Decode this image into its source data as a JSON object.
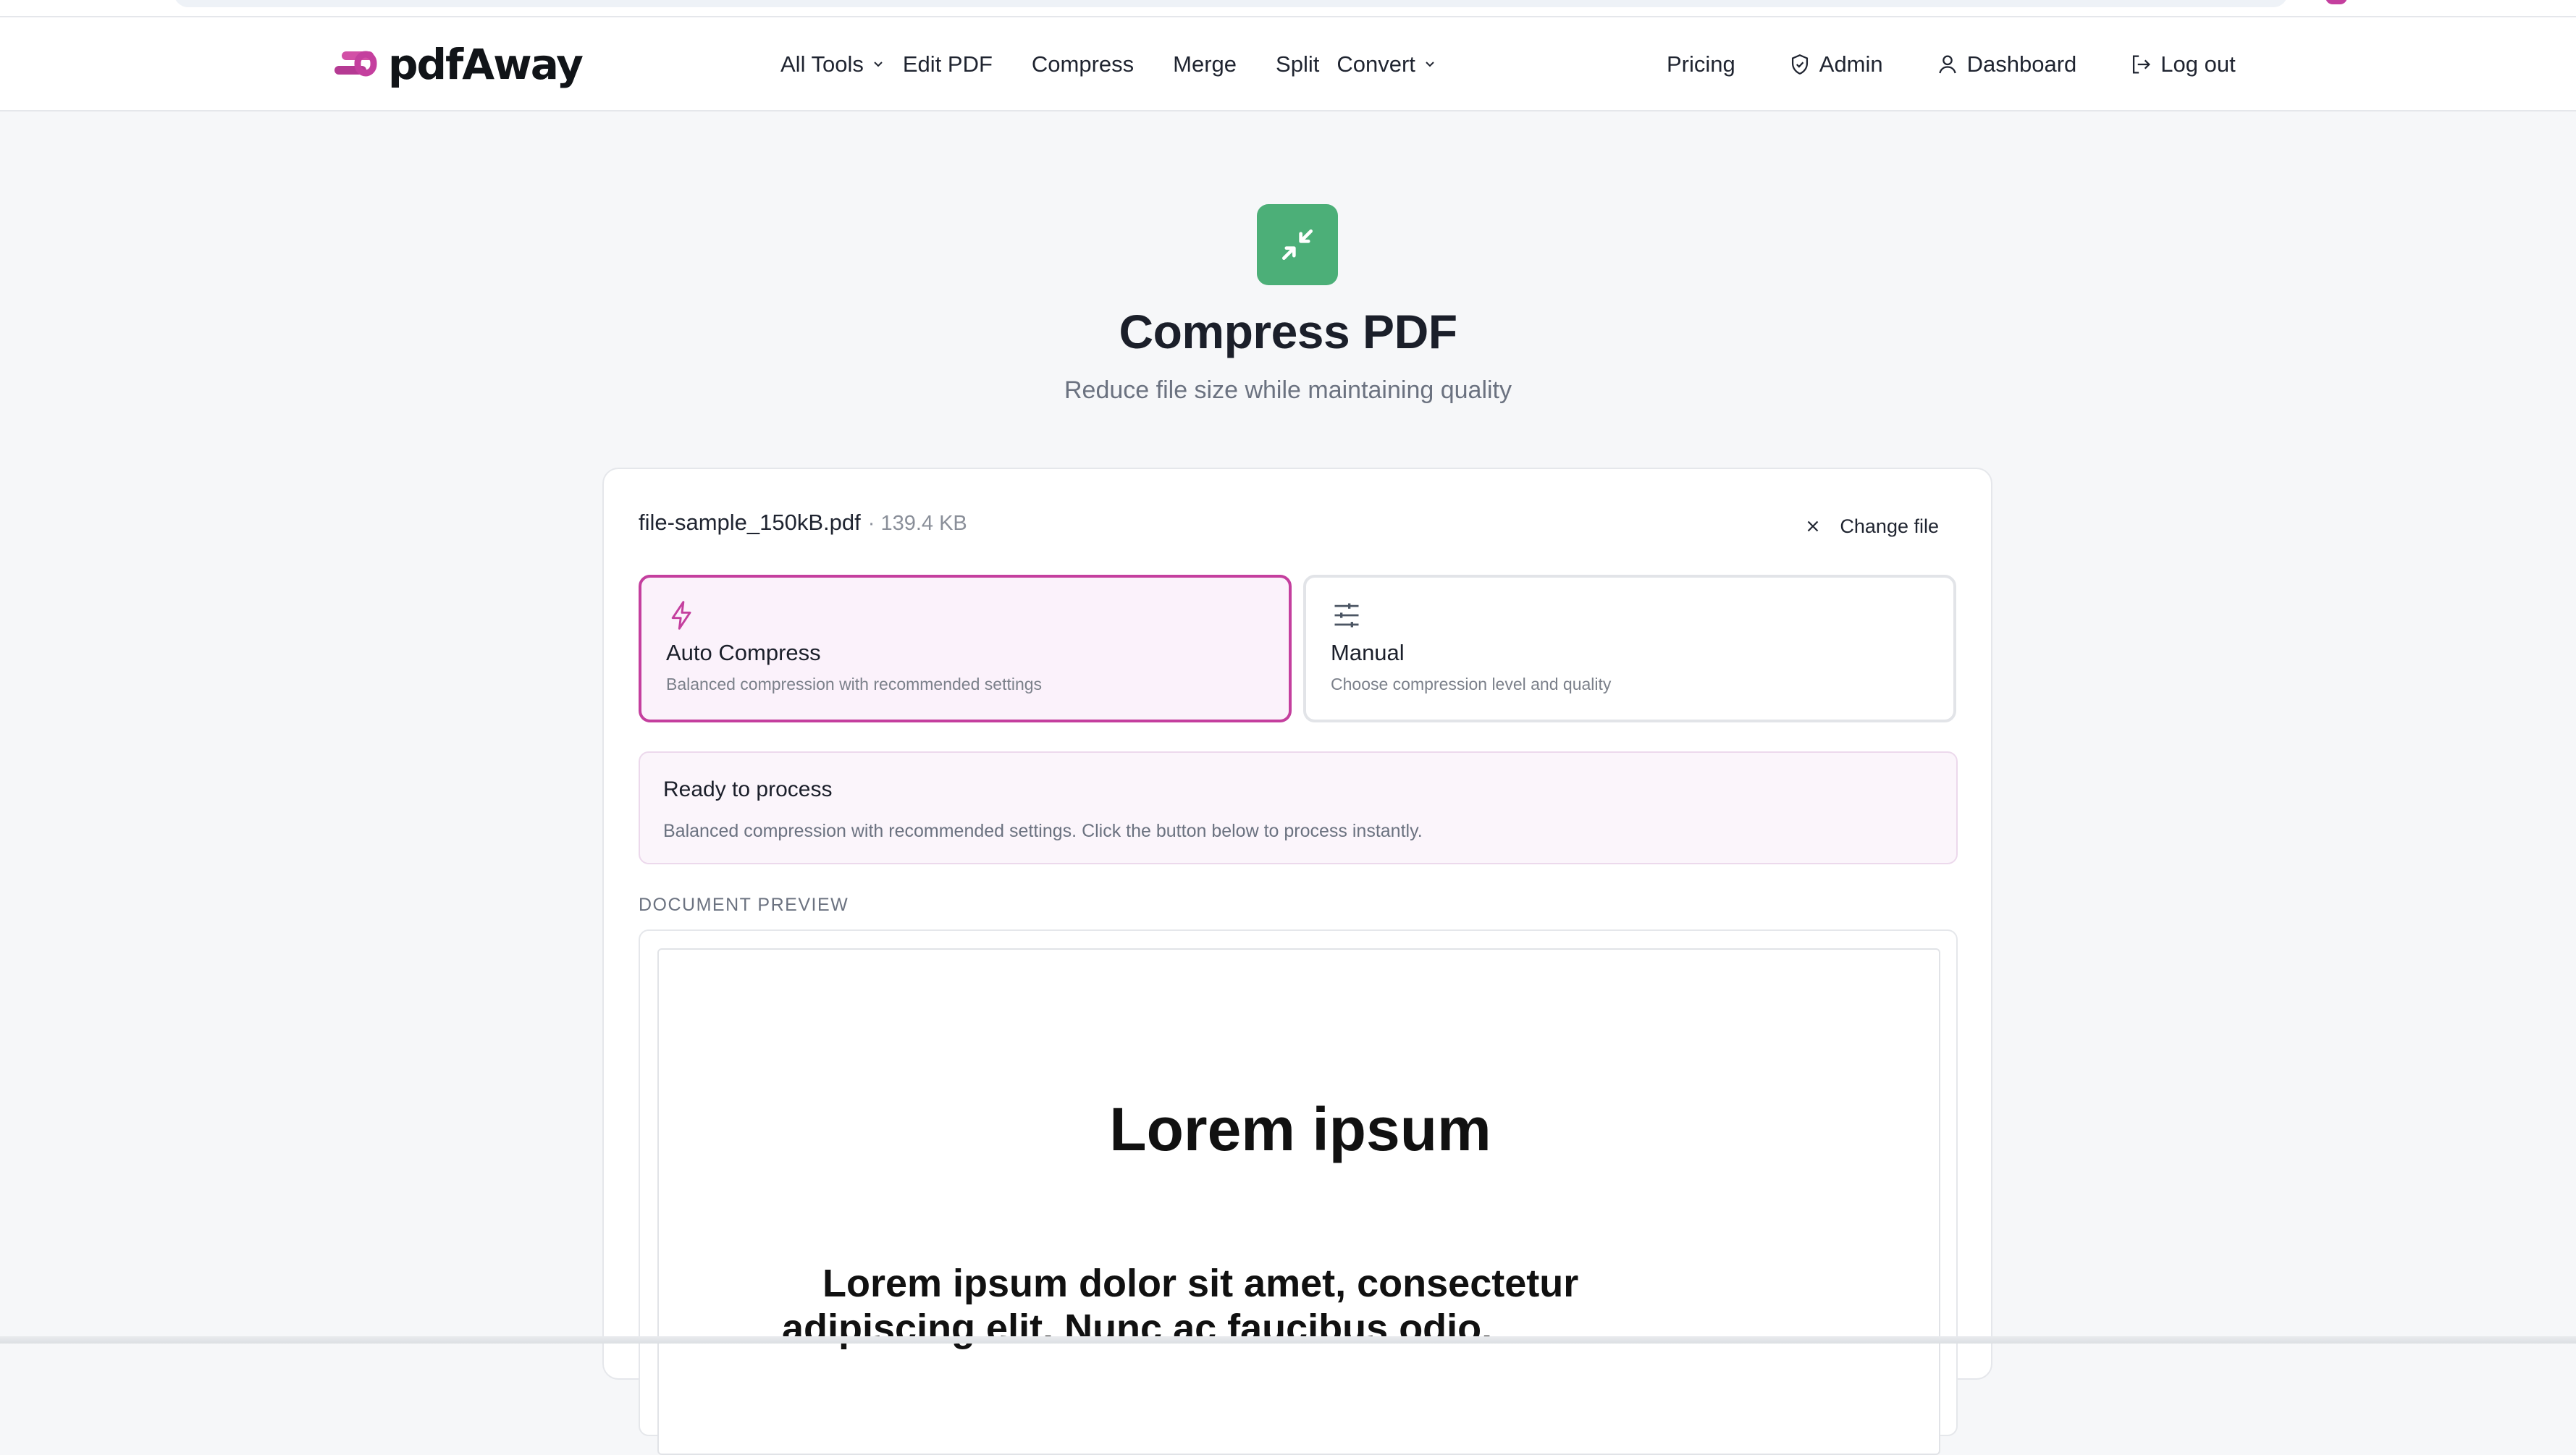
{
  "brand": {
    "name": "pdfAway",
    "accent": "#c43f9e",
    "tool_color": "#4caf78"
  },
  "nav": {
    "all_tools": "All Tools",
    "edit_pdf": "Edit PDF",
    "compress": "Compress",
    "merge": "Merge",
    "split": "Split",
    "convert": "Convert",
    "pricing": "Pricing",
    "admin": "Admin",
    "dashboard": "Dashboard",
    "logout": "Log out"
  },
  "hero": {
    "icon": "compress-arrows-icon",
    "title": "Compress PDF",
    "subtitle": "Reduce file size while maintaining quality"
  },
  "file": {
    "name": "file-sample_150kB.pdf",
    "size": "· 139.4 KB",
    "change_label": "Change file"
  },
  "modes": {
    "auto": {
      "title": "Auto Compress",
      "desc": "Balanced compression with recommended settings",
      "selected": true
    },
    "manual": {
      "title": "Manual",
      "desc": "Choose compression level and quality",
      "selected": false
    }
  },
  "ready": {
    "title": "Ready to process",
    "desc": "Balanced compression with recommended settings. Click the button below to process instantly."
  },
  "preview": {
    "label": "DOCUMENT PREVIEW",
    "doc_title": "Lorem ipsum",
    "doc_body": "Lorem ipsum dolor sit amet, consectetur adipiscing elit. Nunc ac faucibus odio."
  }
}
